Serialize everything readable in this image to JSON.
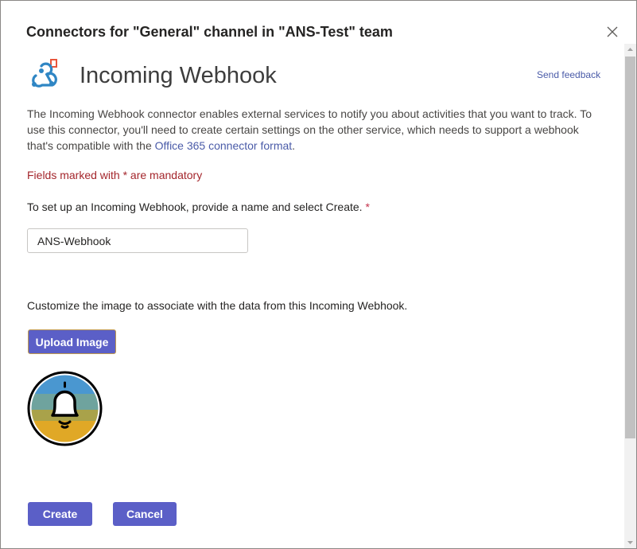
{
  "dialog": {
    "title": "Connectors for \"General\" channel in \"ANS-Test\" team",
    "close_icon": "close-icon"
  },
  "connector": {
    "name": "Incoming Webhook",
    "icon": "webhook-icon",
    "feedback_label": "Send feedback",
    "description_prefix": "The Incoming Webhook connector enables external services to notify you about activities that you want to track. To use this connector, you'll need to create certain settings on the other service, which needs to support a webhook that's compatible with the ",
    "description_link": "Office 365 connector format",
    "description_suffix": "."
  },
  "form": {
    "mandatory_note": "Fields marked with * are mandatory",
    "setup_label": "To set up an Incoming Webhook, provide a name and select Create.",
    "required_marker": "*",
    "name_value": "ANS-Webhook",
    "customize_label": "Customize the image to associate with the data from this Incoming Webhook.",
    "upload_label": "Upload Image",
    "preview_icon": "bell-icon"
  },
  "actions": {
    "create_label": "Create",
    "cancel_label": "Cancel"
  },
  "colors": {
    "primary": "#5b5fc7",
    "link": "#4a5ba8",
    "error": "#a4262c"
  }
}
